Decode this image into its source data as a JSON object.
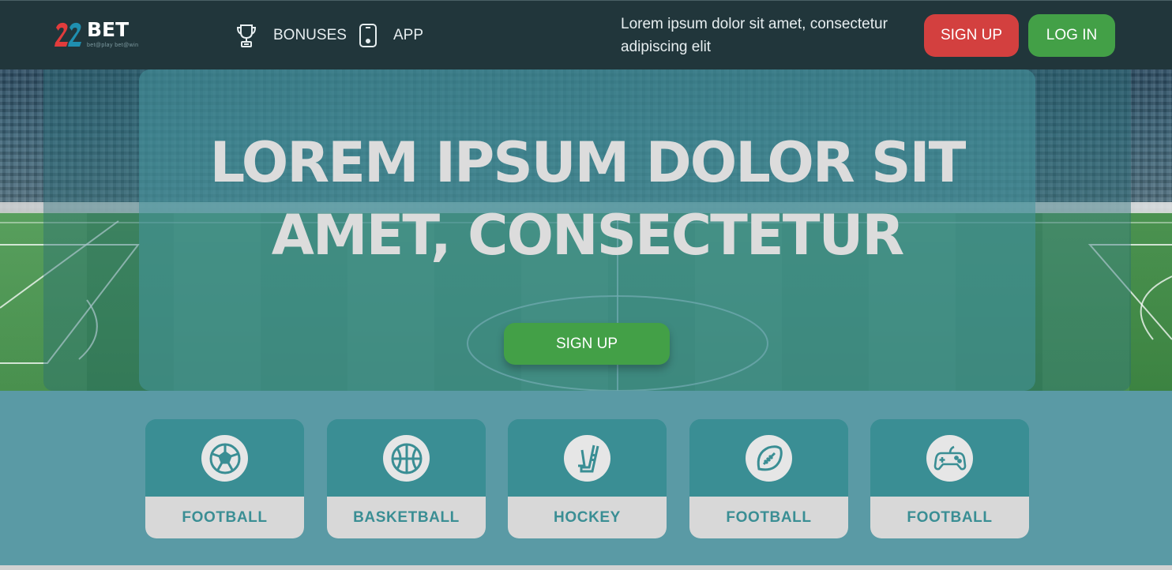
{
  "header": {
    "logo_text": "BET",
    "logo_sub": "bet@play  bet@win",
    "nav": [
      {
        "label": "BONUSES",
        "icon": "trophy-icon"
      },
      {
        "label": "APP",
        "icon": "smartphone-icon"
      }
    ],
    "tagline": "Lorem ipsum dolor sit amet, consectetur adipiscing elit",
    "signup_label": "SIGN UP",
    "login_label": "LOG IN"
  },
  "hero": {
    "title_line1": "LOREM IPSUM DOLOR SIT",
    "title_line2": "AMET, CONSECTETUR",
    "cta_label": "SIGN UP"
  },
  "categories": [
    {
      "label": "FOOTBALL",
      "icon": "soccer-ball-icon"
    },
    {
      "label": "BASKETBALL",
      "icon": "basketball-icon"
    },
    {
      "label": "HOCKEY",
      "icon": "hockey-stick-icon"
    },
    {
      "label": "FOOTBALL",
      "icon": "american-football-icon"
    },
    {
      "label": "FOOTBALL",
      "icon": "gamepad-icon"
    }
  ],
  "colors": {
    "header_bg": "#21363b",
    "signup": "#d3403f",
    "login": "#43a047",
    "accent": "#3a8e94",
    "section_bg": "#5a9aa5"
  }
}
